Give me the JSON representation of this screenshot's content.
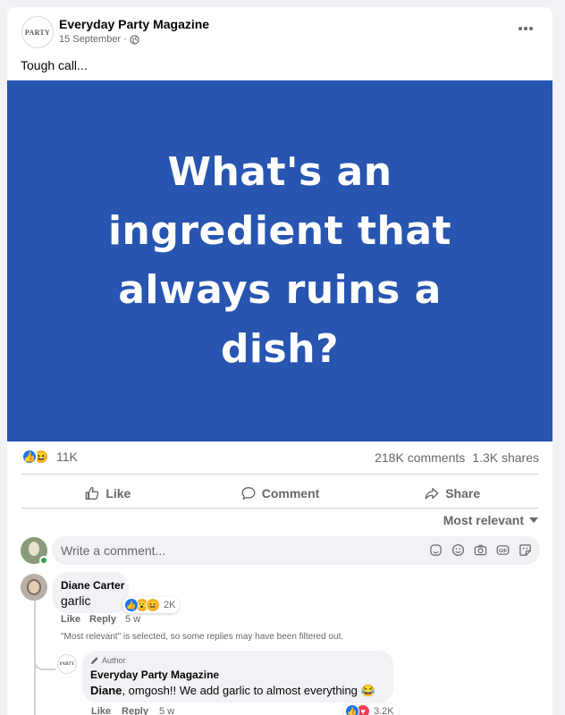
{
  "post": {
    "page_name": "Everyday Party Magazine",
    "logo_text": "PARTY",
    "date": "15 September",
    "dot": "·",
    "caption": "Tough call...",
    "image_text": "What's an\ningredient that\nalways ruins a\ndish?",
    "image_bg": "#2755b0"
  },
  "stats": {
    "reaction_count": "11K",
    "comments": "218K comments",
    "shares": "1.3K shares"
  },
  "actions": {
    "like": "Like",
    "comment": "Comment",
    "share": "Share"
  },
  "sort_label": "Most relevant",
  "comment_input": {
    "placeholder": "Write a comment..."
  },
  "comments": [
    {
      "name": "Diane Carter",
      "text": "garlic",
      "reaction_count": "2K",
      "like": "Like",
      "reply": "Reply",
      "time": "5 w"
    }
  ],
  "filter_notice": "\"Most relevant\" is selected, so some replies may have been filtered out.",
  "reply": {
    "badge": "Author",
    "name": "Everyday Party Magazine",
    "mention": "Diane",
    "text": ", omgosh!! We add garlic to almost everything 😂",
    "reaction_count": "3.2K",
    "like": "Like",
    "reply": "Reply",
    "time": "5 w",
    "logo_text": "PARTY"
  },
  "colors": {
    "accent": "#1877f2",
    "secondary_text": "#65676b",
    "online": "#31a24c"
  }
}
